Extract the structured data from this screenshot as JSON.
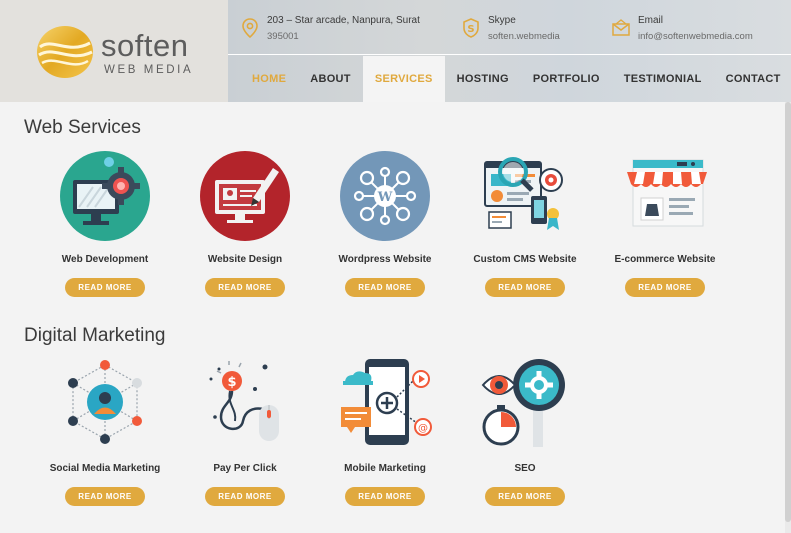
{
  "logo": {
    "name": "soften",
    "sub": "WEB MEDIA"
  },
  "contacts": [
    {
      "icon": "map-pin-icon",
      "title": "203 – Star arcade, Nanpura, Surat",
      "value": "395001"
    },
    {
      "icon": "skype-icon",
      "title": "Skype",
      "value": "soften.webmedia"
    },
    {
      "icon": "envelope-icon",
      "title": "Email",
      "value": "info@softenwebmedia.com"
    }
  ],
  "nav": [
    "HOME",
    "ABOUT",
    "SERVICES",
    "HOSTING",
    "PORTFOLIO",
    "TESTIMONIAL",
    "CONTACT"
  ],
  "nav_active": "SERVICES",
  "sections": {
    "web": {
      "title": "Web Services",
      "items": [
        {
          "label": "Web Development",
          "icon": "monitor-gear-icon"
        },
        {
          "label": "Website Design",
          "icon": "design-pen-icon"
        },
        {
          "label": "Wordpress Website",
          "icon": "wordpress-network-icon"
        },
        {
          "label": "Custom CMS Website",
          "icon": "cms-dashboard-icon"
        },
        {
          "label": "E-commerce Website",
          "icon": "ecommerce-store-icon"
        }
      ]
    },
    "digital": {
      "title": "Digital Marketing",
      "items": [
        {
          "label": "Social Media Marketing",
          "icon": "social-network-icon"
        },
        {
          "label": "Pay Per Click",
          "icon": "ppc-mouse-icon"
        },
        {
          "label": "Mobile Marketing",
          "icon": "mobile-marketing-icon"
        },
        {
          "label": "SEO",
          "icon": "seo-magnifier-icon"
        }
      ]
    }
  },
  "read_more": "READ MORE",
  "colors": {
    "accent": "#e0a93e",
    "text": "#333333",
    "bg": "#f3f3f3"
  }
}
